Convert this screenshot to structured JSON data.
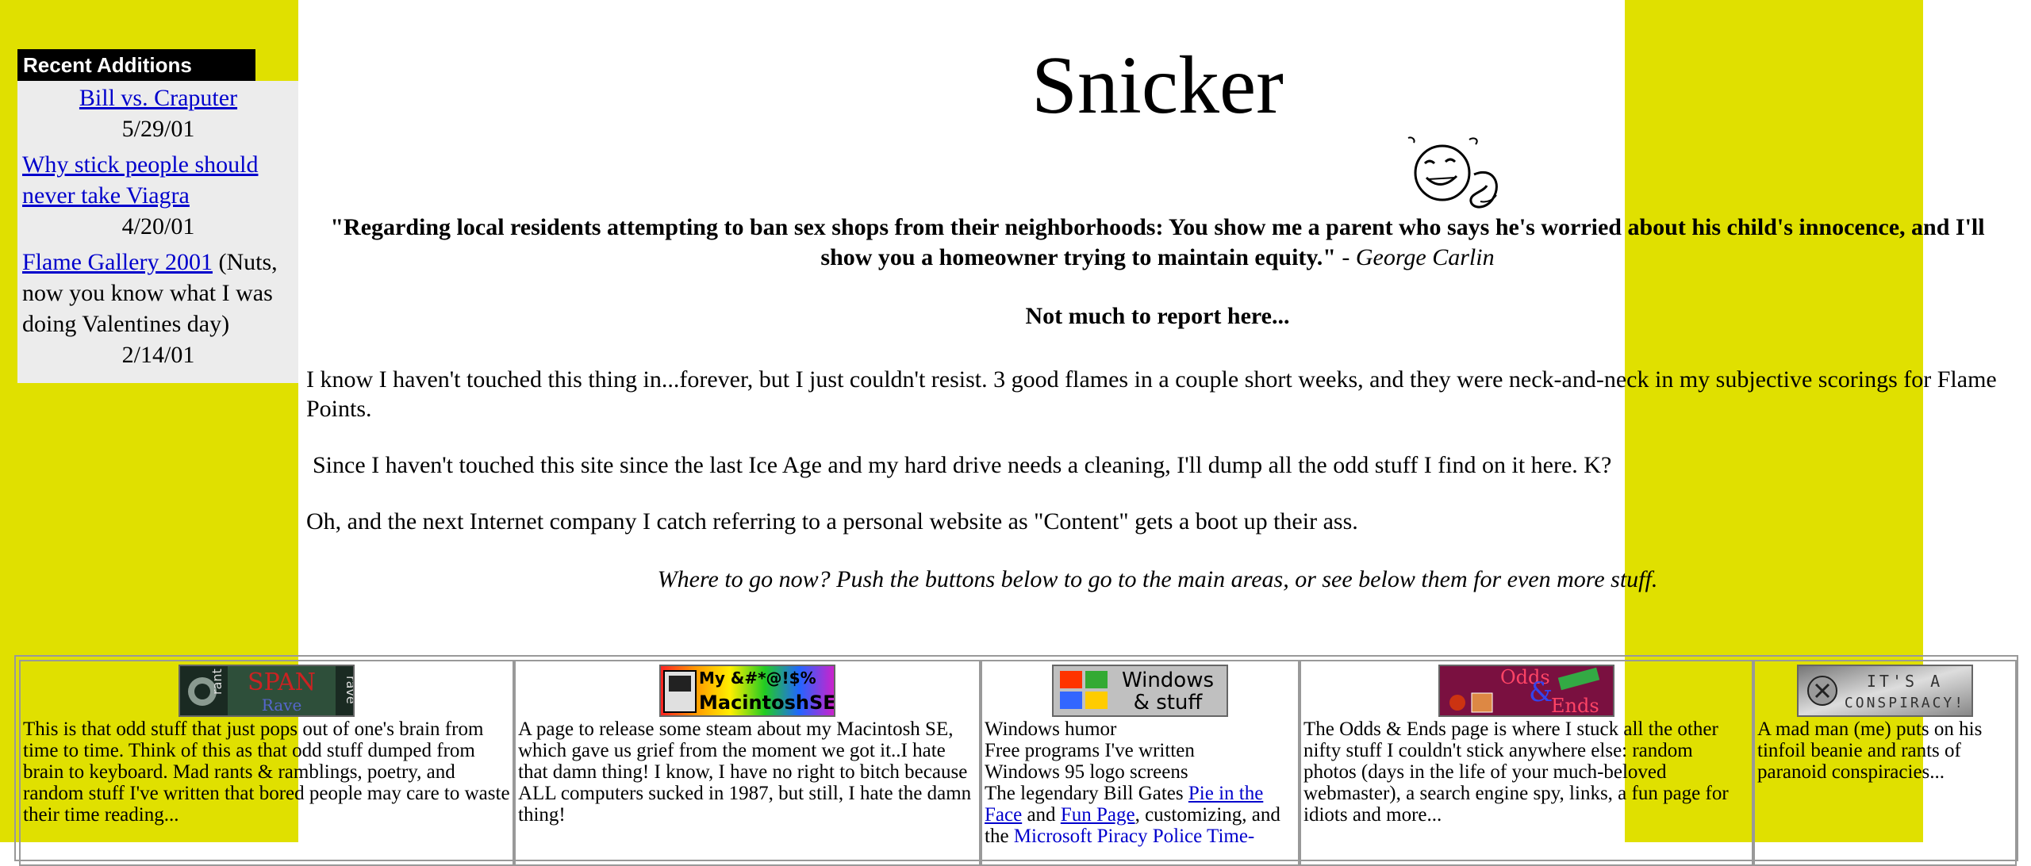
{
  "sidebar": {
    "heading": "Recent Additions",
    "items": [
      {
        "link": "Bill vs. Craputer",
        "note": "",
        "date": "5/29/01"
      },
      {
        "link": "Why stick people should never take Viagra",
        "note": "",
        "date": "4/20/01"
      },
      {
        "link": "Flame Gallery 2001",
        "note": " (Nuts, now you know what I was doing Valentines day)",
        "date": "2/14/01"
      }
    ]
  },
  "header": {
    "title": "Snicker",
    "quote": "\"Regarding local residents attempting to ban sex shops from their neighborhoods: You show me a parent who says he's worried about his child's innocence, and I'll show you a homeowner trying to maintain equity.\"",
    "quote_attrib": " - George Carlin",
    "subhead": "Not much to report here..."
  },
  "body": {
    "p1": "I know I haven't touched this thing in...forever, but I just couldn't resist. 3 good flames in a couple short weeks, and they were neck-and-neck in my subjective scorings for Flame Points.",
    "p2": "Since I haven't touched this site since the last Ice Age and my hard drive needs a cleaning, I'll dump all the odd stuff I find on it here. K?",
    "p3": "Oh, and the next Internet company I catch referring to a personal website as \"Content\" gets a boot up their ass.",
    "nav_hint": "Where to go now? Push the buttons below to go to the main areas, or see below them for even more stuff."
  },
  "buttons": {
    "rant": {
      "img_text_side": "rant",
      "img_text_main": "SPAN",
      "img_text_sub": "Rave",
      "img_text_side2": "rave",
      "desc": "This is that odd stuff that just pops out of one's brain from time to time. Think of this as that odd stuff dumped from brain to keyboard. Mad rants & ramblings, poetry, and random stuff I've written that bored people may care to waste their time reading..."
    },
    "mac": {
      "img_text_top": "My &#*@!$%",
      "img_text_bottom": "MacintoshSE",
      "desc": "A page to release some steam about my Macintosh SE, which gave us grief from the moment we got it..I hate that damn thing! I know, I have no right to bitch because ALL computers sucked in 1987, but still, I hate the damn thing!"
    },
    "windows": {
      "img_text_1": "Windows",
      "img_text_2": "& stuff",
      "line1": "Windows humor",
      "line2": "Free programs I've written",
      "line3": "Windows 95 logo screens",
      "line4_pre": "The legendary Bill Gates ",
      "line4_link1": "Pie in the Face",
      "line4_mid": " and ",
      "line4_link2": "Fun Page",
      "line4_post": ", customizing, and the ",
      "line5_link": "Microsoft Piracy Police Time-"
    },
    "odds": {
      "img_text_1": "Odds",
      "img_text_2": "&",
      "img_text_3": "Ends",
      "desc": "The Odds & Ends page is where I stuck all the other nifty stuff I couldn't stick anywhere else: random photos (days in the life of your much-beloved webmaster), a search engine spy, links, a fun page for idiots and more..."
    },
    "conspiracy": {
      "img_text_1": "IT'S A",
      "img_text_2": "CONSPIRACY!",
      "desc": "A mad man (me) puts on his tinfoil beanie and rants of paranoid conspiracies..."
    }
  },
  "colors": {
    "stripe": "#e0e000",
    "link": "#0000cc",
    "sidebar_bg": "#ececec"
  }
}
